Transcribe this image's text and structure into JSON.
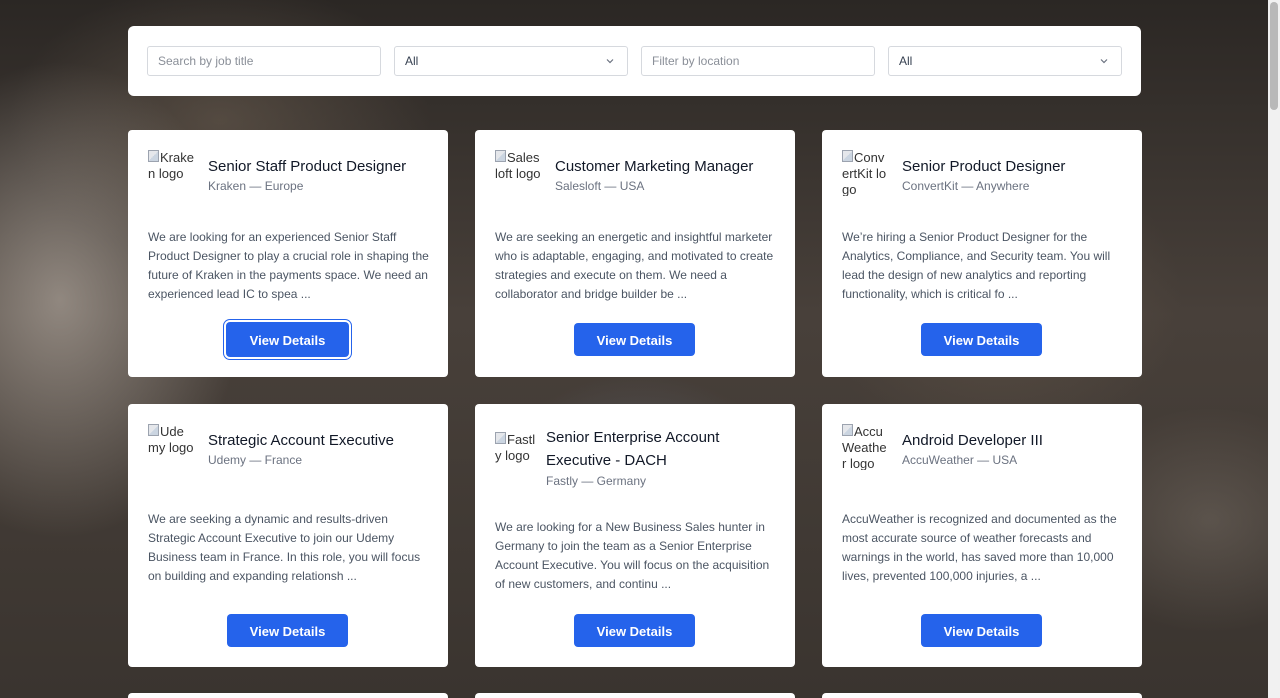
{
  "filters": {
    "job_title": {
      "placeholder": "Search by job title",
      "value": ""
    },
    "select_1": {
      "value": "All"
    },
    "location": {
      "placeholder": "Filter by location",
      "value": ""
    },
    "select_2": {
      "value": "All"
    }
  },
  "jobs": [
    {
      "title": "Senior Staff Product Designer",
      "meta": "Kraken — Europe",
      "logo_alt": "Kraken logo",
      "description": "We are looking for an experienced Senior Staff Product Designer to play a crucial role in shaping the future of Kraken in the payments space. We need an experienced lead IC to spea ...",
      "button": "View Details"
    },
    {
      "title": "Customer Marketing Manager",
      "meta": "Salesloft — USA",
      "logo_alt": "Salesloft logo",
      "description": "We are seeking an energetic and insightful marketer who is adaptable, engaging, and motivated to create strategies and execute on them. We need a collaborator and bridge builder be ...",
      "button": "View Details"
    },
    {
      "title": "Senior Product Designer",
      "meta": "ConvertKit — Anywhere",
      "logo_alt": "ConvertKit logo",
      "description": "We’re hiring a Senior Product Designer for the Analytics, Compliance, and Security team. You will lead the design of new analytics and reporting functionality, which is critical fo ...",
      "button": "View Details"
    },
    {
      "title": "Strategic Account Executive",
      "meta": "Udemy — France",
      "logo_alt": "Udemy logo",
      "description": "We are seeking a dynamic and results-driven Strategic Account Executive to join our Udemy Business team in France. In this role, you will focus on building and expanding relationsh ...",
      "button": "View Details"
    },
    {
      "title": "Senior Enterprise Account Executive - DACH",
      "meta": "Fastly — Germany",
      "logo_alt": "Fastly logo",
      "description": "We are looking for a New Business Sales hunter in Germany to join the team as a Senior Enterprise Account Executive. You will focus on the acquisition of new customers, and continu ...",
      "button": "View Details"
    },
    {
      "title": "Android Developer III",
      "meta": "AccuWeather — USA",
      "logo_alt": "AccuWeather logo",
      "description": "AccuWeather is recognized and documented as the most accurate source of weather forecasts and warnings in the world, has saved more than 10,000 lives, prevented 100,000 injuries, a ...",
      "button": "View Details"
    }
  ]
}
